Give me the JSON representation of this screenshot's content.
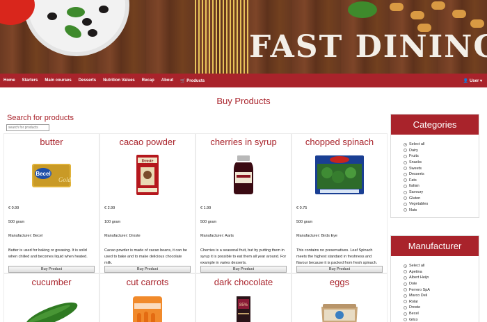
{
  "hero": {
    "title": "FAST DINING"
  },
  "nav": {
    "items": [
      "Home",
      "Starters",
      "Main courses",
      "Desserts",
      "Nutrition Values",
      "Recap",
      "About"
    ],
    "cart_label": "Products",
    "user_label": "User"
  },
  "page": {
    "title": "Buy Products"
  },
  "search": {
    "heading": "Search for products",
    "placeholder": "search for products"
  },
  "buy_label": "Buy Product",
  "products": [
    {
      "name": "butter",
      "price": "€ 0.99",
      "weight": "500 gram",
      "manufacturer": "Manufacturer: Becel",
      "description": "Butter is used for baking or greasing. It is solid when chilled and becomes liquid when heated.",
      "image": "butter-package-icon"
    },
    {
      "name": "cacao powder",
      "price": "€ 2.99",
      "weight": "100 gram",
      "manufacturer": "Manufacturer: Droste",
      "description": "Cacao powder is made of cacao beans, it can be used to bake and to make delicious chocolate milk.",
      "image": "cacao-tin-icon"
    },
    {
      "name": "cherries in syrup",
      "price": "€ 1.99",
      "weight": "500 gram",
      "manufacturer": "Manufacturer: Aarts",
      "description": "Cherries is a seasonal fruit, but by putting them in syrup it is possible to eat them all year around. For example in varies desserts.",
      "image": "jar-icon"
    },
    {
      "name": "chopped spinach",
      "price": "€ 0.75",
      "weight": "500 gram",
      "manufacturer": "Manufacturer: Birds Eye",
      "description": "This contains no preservatives. Leaf Spinach meets the highest standard in freshness and flavour because it is packed from fresh spinach.",
      "image": "spinach-box-icon"
    },
    {
      "name": "cucumber",
      "image": "cucumber-icon"
    },
    {
      "name": "cut carrots",
      "image": "carrot-bag-icon"
    },
    {
      "name": "dark chocolate",
      "image": "chocolate-bar-icon"
    },
    {
      "name": "eggs",
      "image": "egg-carton-icon"
    }
  ],
  "categories": {
    "heading": "Categories",
    "options": [
      "Select all",
      "Dairy",
      "Fruits",
      "Snacks",
      "Sweets",
      "Desserts",
      "Fats",
      "Italian",
      "Savoury",
      "Gluten",
      "Vegetables",
      "Nuts"
    ],
    "selected": "Select all"
  },
  "manufacturer": {
    "heading": "Manufacturer",
    "options": [
      "Select all",
      "Apetina",
      "Albert Heijn",
      "Dole",
      "Ferrero SpA",
      "Marco Deli",
      "Rolar",
      "Droste",
      "Becel",
      "Gilco"
    ],
    "selected": "Select all"
  },
  "colors": {
    "brand_red": "#a9232b"
  }
}
